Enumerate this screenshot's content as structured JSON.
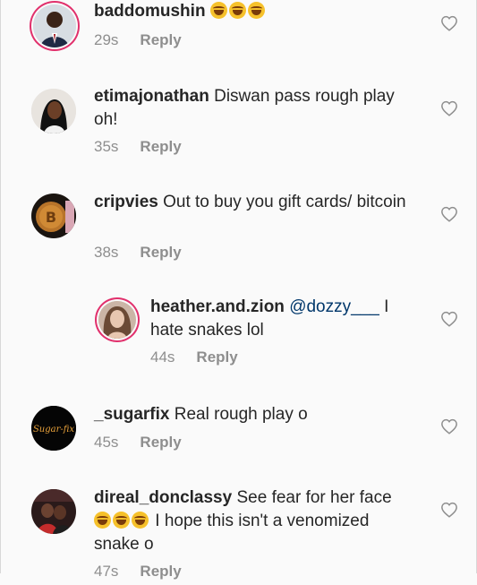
{
  "comments": [
    {
      "username": "baddomushin",
      "text": "",
      "emoji_count": 3,
      "time": "29s",
      "reply": "Reply",
      "avatar": "person-suit-avatar"
    },
    {
      "username": "etimajonathan",
      "text": "Diswan pass rough play oh!",
      "time": "35s",
      "reply": "Reply",
      "avatar": "woman-portrait-avatar"
    },
    {
      "username": "cripvies",
      "text": "Out to buy you gift cards/ bitcoin",
      "time": "38s",
      "reply": "Reply",
      "avatar": "bitcoin-coin-avatar"
    },
    {
      "username": "heather.and.zion",
      "mention": "@dozzy___",
      "text": "I hate snakes lol",
      "time": "44s",
      "reply": "Reply",
      "avatar": "woman-selfie-avatar"
    },
    {
      "username": "_sugarfix",
      "text": "Real rough play o",
      "time": "45s",
      "reply": "Reply",
      "avatar": "sugarfix-logo-avatar"
    },
    {
      "username": "direal_donclassy",
      "text_before": "See fear for her face",
      "emoji_count": 3,
      "text_after": "I hope this isn't a venomized snake o",
      "time": "47s",
      "reply": "Reply",
      "avatar": "couple-photo-avatar"
    }
  ],
  "colors": {
    "username": "#262626",
    "meta": "#8e8e8e",
    "mention": "#00376b",
    "story_ring": "#e1306c"
  },
  "icons": {
    "like": "heart-outline-icon",
    "emoji": "face-with-tears-of-joy-icon"
  }
}
